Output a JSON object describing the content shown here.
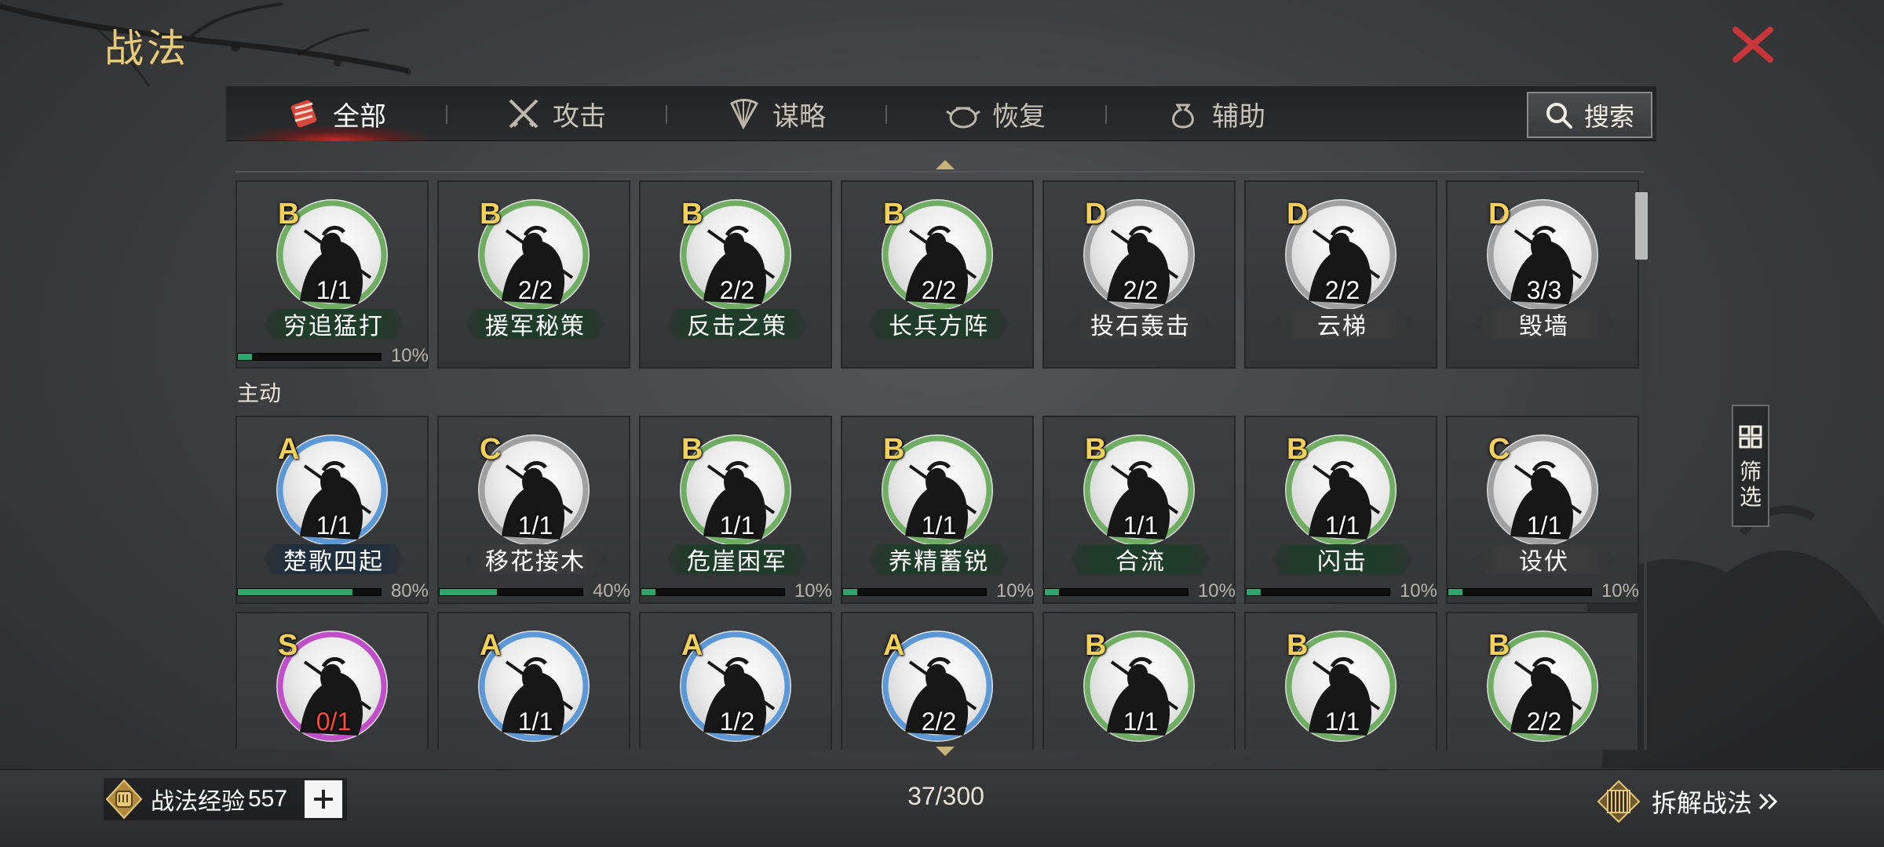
{
  "header": {
    "title": "战法",
    "close_icon": "close-x-icon"
  },
  "tabs": [
    {
      "label": "全部",
      "icon": "scroll-bundle-icon",
      "active": true
    },
    {
      "label": "攻击",
      "icon": "crossed-swords-icon",
      "active": false
    },
    {
      "label": "谋略",
      "icon": "feather-fan-icon",
      "active": false
    },
    {
      "label": "恢复",
      "icon": "medicine-pot-icon",
      "active": false
    },
    {
      "label": "辅助",
      "icon": "pouch-icon",
      "active": false
    }
  ],
  "search": {
    "label": "搜索",
    "icon": "search-icon"
  },
  "sections": {
    "active_label": "主动"
  },
  "colors": {
    "green_ring": "#6fae62",
    "blue_ring": "#5c98d6",
    "gray_ring": "#a0a0a0",
    "purple_ring": "#c04ec8",
    "progress_fill": "#2ea56a",
    "title_gold": "#e8c978",
    "close_red": "#c8363a"
  },
  "rows": [
    {
      "cards": [
        {
          "grade": "B",
          "count": "1/1",
          "name": "穷追猛打",
          "ring": "green",
          "progress": 10,
          "pct": "10%"
        },
        {
          "grade": "B",
          "count": "2/2",
          "name": "援军秘策",
          "ring": "green",
          "progress": null,
          "pct": ""
        },
        {
          "grade": "B",
          "count": "2/2",
          "name": "反击之策",
          "ring": "green",
          "progress": null,
          "pct": ""
        },
        {
          "grade": "B",
          "count": "2/2",
          "name": "长兵方阵",
          "ring": "green",
          "progress": null,
          "pct": ""
        },
        {
          "grade": "D",
          "count": "2/2",
          "name": "投石轰击",
          "ring": "gray",
          "progress": null,
          "pct": ""
        },
        {
          "grade": "D",
          "count": "2/2",
          "name": "云梯",
          "ring": "gray",
          "progress": null,
          "pct": ""
        },
        {
          "grade": "D",
          "count": "3/3",
          "name": "毁墙",
          "ring": "gray",
          "progress": null,
          "pct": ""
        }
      ]
    },
    {
      "cards": [
        {
          "grade": "A",
          "count": "1/1",
          "name": "楚歌四起",
          "ring": "blue",
          "progress": 80,
          "pct": "80%"
        },
        {
          "grade": "C",
          "count": "1/1",
          "name": "移花接木",
          "ring": "gray",
          "progress": 40,
          "pct": "40%"
        },
        {
          "grade": "B",
          "count": "1/1",
          "name": "危崖困军",
          "ring": "green",
          "progress": 10,
          "pct": "10%"
        },
        {
          "grade": "B",
          "count": "1/1",
          "name": "养精蓄锐",
          "ring": "green",
          "progress": 10,
          "pct": "10%"
        },
        {
          "grade": "B",
          "count": "1/1",
          "name": "合流",
          "ring": "green",
          "progress": 10,
          "pct": "10%"
        },
        {
          "grade": "B",
          "count": "1/1",
          "name": "闪击",
          "ring": "green",
          "progress": 10,
          "pct": "10%"
        },
        {
          "grade": "C",
          "count": "1/1",
          "name": "设伏",
          "ring": "gray",
          "progress": 10,
          "pct": "10%"
        }
      ]
    },
    {
      "cards": [
        {
          "grade": "S",
          "count": "0/1",
          "name": "",
          "ring": "purple",
          "progress": null,
          "pct": "",
          "count_red": true
        },
        {
          "grade": "A",
          "count": "1/1",
          "name": "",
          "ring": "blue",
          "progress": null,
          "pct": ""
        },
        {
          "grade": "A",
          "count": "1/2",
          "name": "",
          "ring": "blue",
          "progress": null,
          "pct": ""
        },
        {
          "grade": "A",
          "count": "2/2",
          "name": "",
          "ring": "blue",
          "progress": null,
          "pct": ""
        },
        {
          "grade": "B",
          "count": "1/1",
          "name": "",
          "ring": "green",
          "progress": null,
          "pct": ""
        },
        {
          "grade": "B",
          "count": "1/1",
          "name": "",
          "ring": "green",
          "progress": null,
          "pct": ""
        },
        {
          "grade": "B",
          "count": "2/2",
          "name": "",
          "ring": "green",
          "progress": null,
          "pct": ""
        }
      ]
    }
  ],
  "filter": {
    "label": "筛选",
    "icon": "grid-filter-icon"
  },
  "footer": {
    "exp_label": "战法经验",
    "exp_value": "557",
    "exp_icon": "fist-coin-icon",
    "add_icon": "plus-icon",
    "capacity": "37/300",
    "decompose_label": "拆解战法",
    "decompose_icon": "scroll-rack-icon",
    "decompose_arrow": "double-chevron-right-icon"
  }
}
